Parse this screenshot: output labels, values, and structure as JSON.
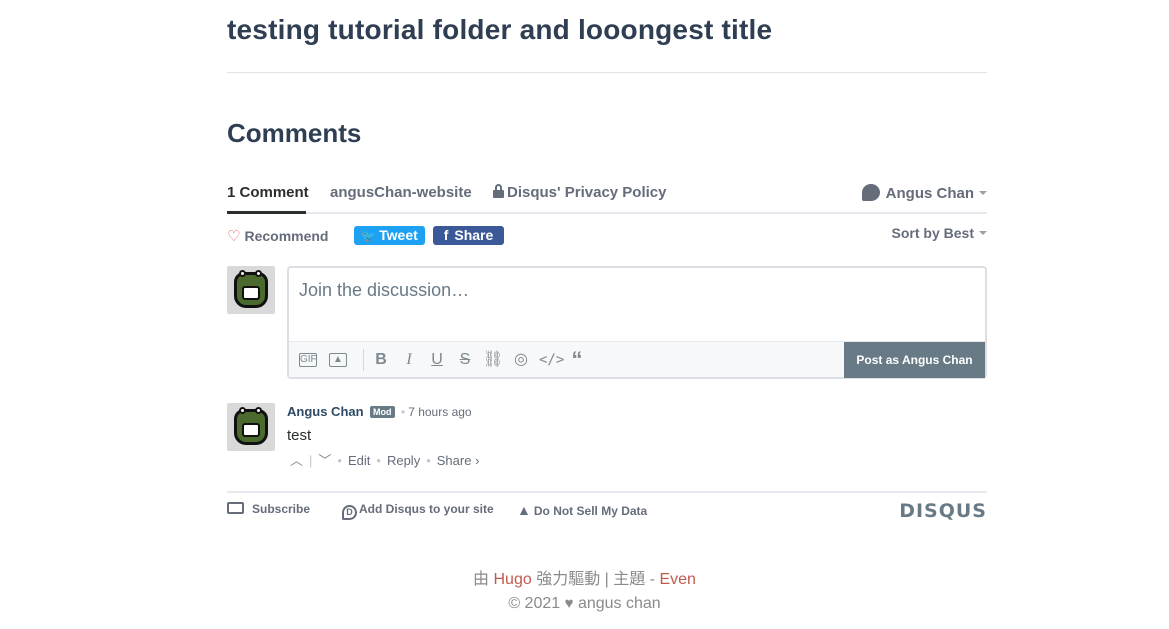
{
  "post": {
    "title": "testing tutorial folder and looongest title"
  },
  "comments_section": {
    "heading": "Comments"
  },
  "disqus_nav": {
    "tabs": [
      {
        "label": "1 Comment"
      },
      {
        "label": "angusChan-website"
      },
      {
        "label": "Disqus' Privacy Policy"
      }
    ],
    "user_menu": "Angus Chan"
  },
  "actions": {
    "recommend": "Recommend",
    "tweet": "Tweet",
    "share": "Share",
    "sort": "Sort by Best"
  },
  "composer": {
    "placeholder": "Join the discussion…",
    "post_button": "Post as Angus Chan",
    "tools": [
      "gif-icon",
      "image-icon",
      "bold-icon",
      "italic-icon",
      "underline-icon",
      "strikethrough-icon",
      "link-icon",
      "spoiler-icon",
      "code-icon",
      "quote-icon"
    ]
  },
  "comment": {
    "author": "Angus Chan",
    "badge": "Mod",
    "time": "7 hours ago",
    "body": "test",
    "edit": "Edit",
    "reply": "Reply",
    "share": "Share ›"
  },
  "disqus_footer": {
    "subscribe": "Subscribe",
    "add_disqus": "Add Disqus to your site",
    "do_not_sell": "Do Not Sell My Data",
    "logo": "DISQUS"
  },
  "site_footer": {
    "powered_prefix": "由",
    "hugo": "Hugo",
    "powered_mid": "強力驅動 | 主題 -",
    "theme": "Even",
    "copyright_prefix": "© 2021",
    "owner": "angus chan"
  },
  "colors": {
    "title": "#2f3e52",
    "tweet": "#1da1f2",
    "facebook": "#3b5998",
    "post_button": "#687a86",
    "footer_link": "#c05b4d"
  }
}
